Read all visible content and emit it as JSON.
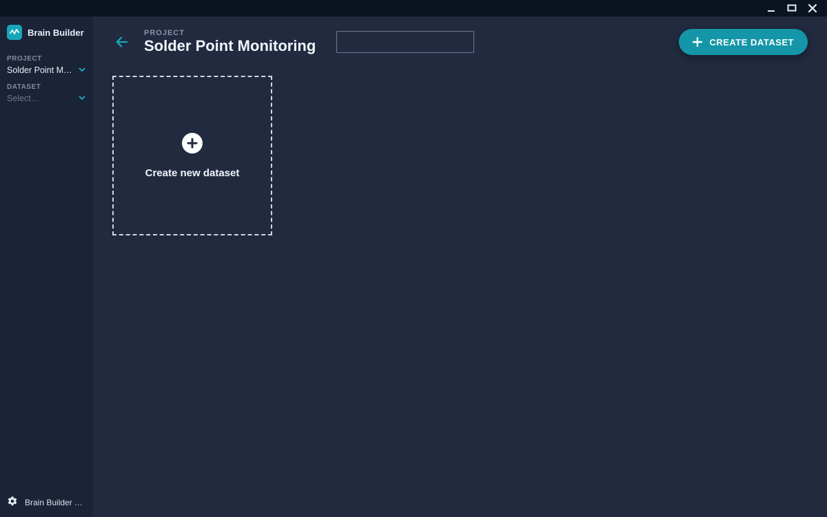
{
  "app": {
    "name": "Brain Builder"
  },
  "sidebar": {
    "project": {
      "label": "PROJECT",
      "value": "Solder Point M…"
    },
    "dataset": {
      "label": "DATASET",
      "placeholder": "Select…"
    },
    "footer": "Brain Builder T…"
  },
  "header": {
    "eyebrow": "PROJECT",
    "title": "Solder Point Monitoring",
    "search_placeholder": "",
    "create_button": "CREATE DATASET"
  },
  "content": {
    "create_tile_label": "Create new dataset"
  }
}
